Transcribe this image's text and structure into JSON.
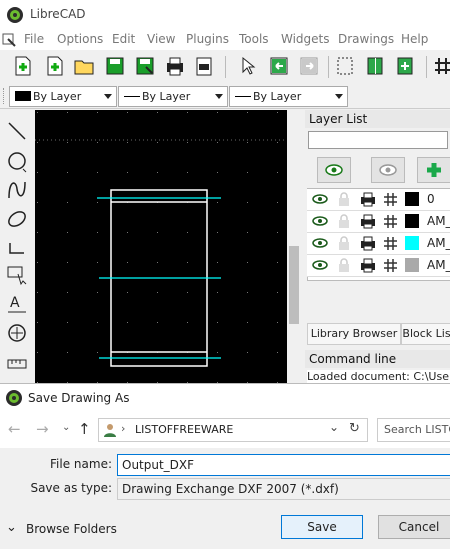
{
  "app": {
    "title": "LibreCAD"
  },
  "menu": [
    "File",
    "Options",
    "Edit",
    "View",
    "Plugins",
    "Tools",
    "Widgets",
    "Drawings",
    "Help"
  ],
  "pen_toolbar": {
    "color": "By Layer",
    "width": "By Layer",
    "type": "By Layer"
  },
  "layer_list": {
    "title": "Layer List",
    "search_value": "",
    "layers": [
      {
        "name": "0",
        "color": "#000000"
      },
      {
        "name": "AM_",
        "color": "#000000"
      },
      {
        "name": "AM_",
        "color": "#00ffff"
      },
      {
        "name": "AM_",
        "color": "#a9a9a9"
      }
    ],
    "tabs": [
      "Library Browser",
      "Block Lis"
    ]
  },
  "command_line": {
    "title": "Command line",
    "text": "Loaded document: C:\\Users\\"
  },
  "dialog": {
    "title": "Save Drawing As",
    "path_root": "›",
    "path": "LISTOFFREEWARE",
    "search_placeholder": "Search LISTO",
    "file_name_label": "File name:",
    "file_name_value": "Output_DXF",
    "save_type_label": "Save as type:",
    "save_type_value": "Drawing Exchange DXF 2007 (*.dxf)",
    "browse_folders": "Browse Folders",
    "save_label": "Save",
    "cancel_label": "Cancel"
  },
  "colors": {
    "accent": "#0078d7",
    "drawing_line": "#ffffff",
    "cyan_line": "#00ffff",
    "canvas_bg": "#000000"
  }
}
